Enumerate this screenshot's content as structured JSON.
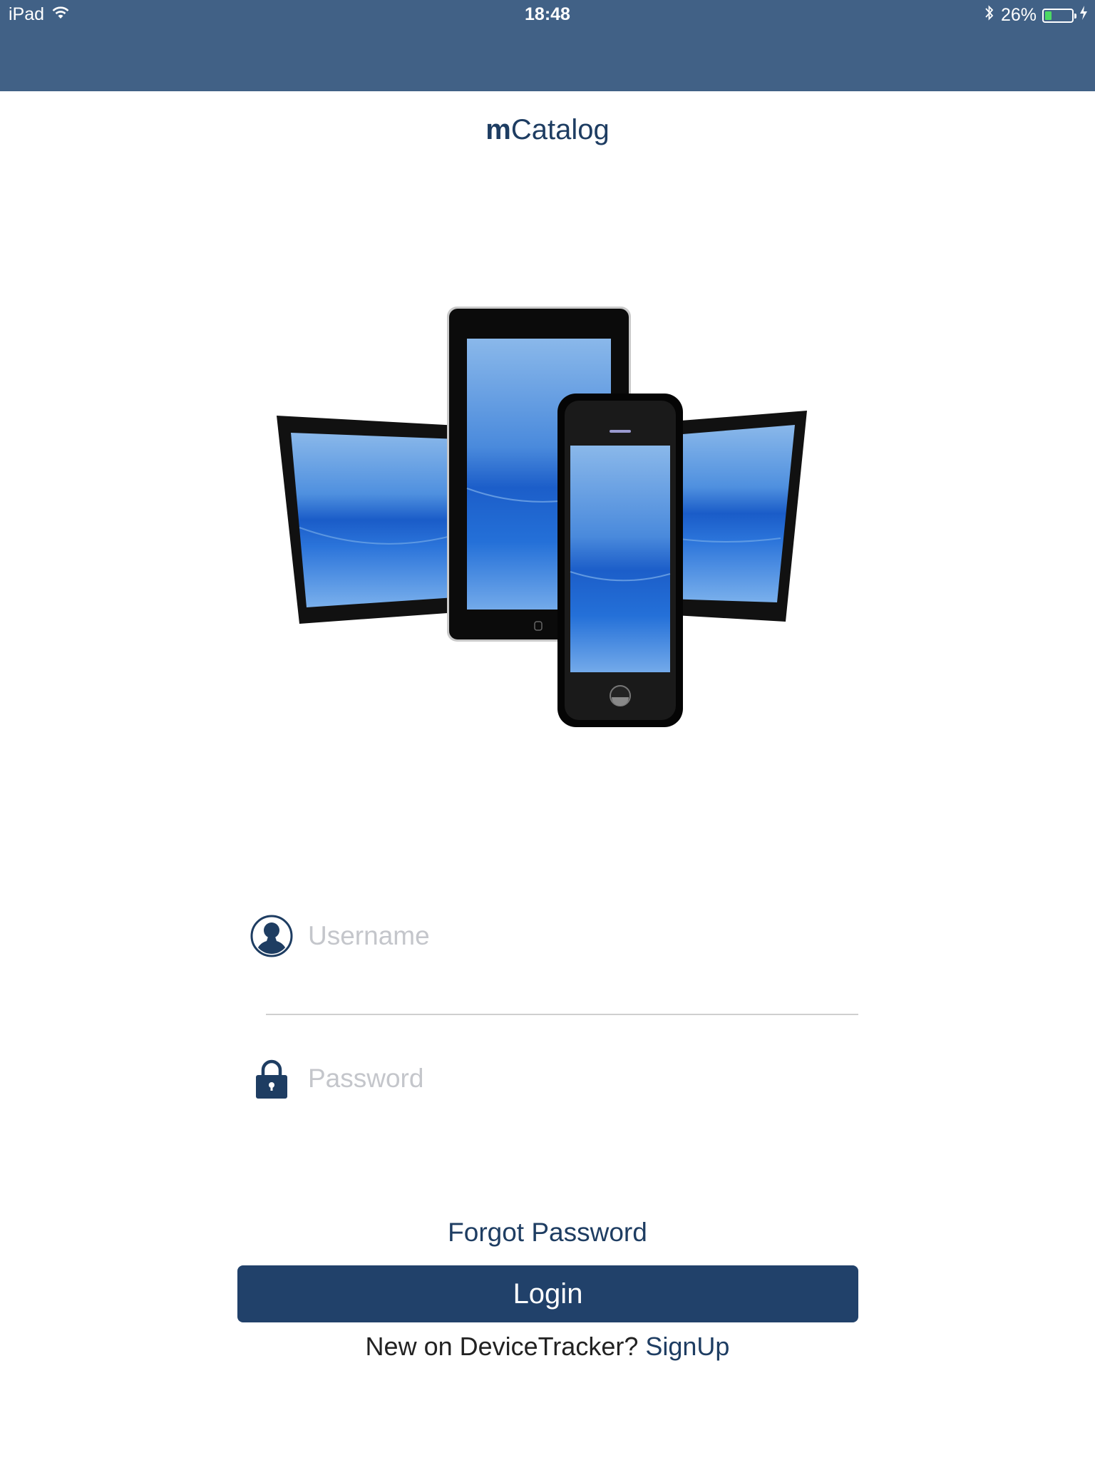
{
  "status_bar": {
    "device": "iPad",
    "time": "18:48",
    "battery": "26%",
    "battery_level": 0.26,
    "background_color": "#416186",
    "icons": [
      "wifi-icon",
      "bluetooth-icon",
      "battery-icon",
      "charging-icon"
    ]
  },
  "app": {
    "title_prefix": "m",
    "title_rest": "Catalog",
    "brand_color": "#1e3d62"
  },
  "hero": {
    "image": "devices-illustration"
  },
  "login_form": {
    "username_placeholder": "Username",
    "password_placeholder": "Password",
    "username_icon": "user-icon",
    "password_icon": "lock-icon",
    "forgot_password": "Forgot Password",
    "login_button": "Login",
    "login_button_color": "#21416a",
    "signup_prompt": "New on DeviceTracker?",
    "signup_link": "SignUp"
  }
}
